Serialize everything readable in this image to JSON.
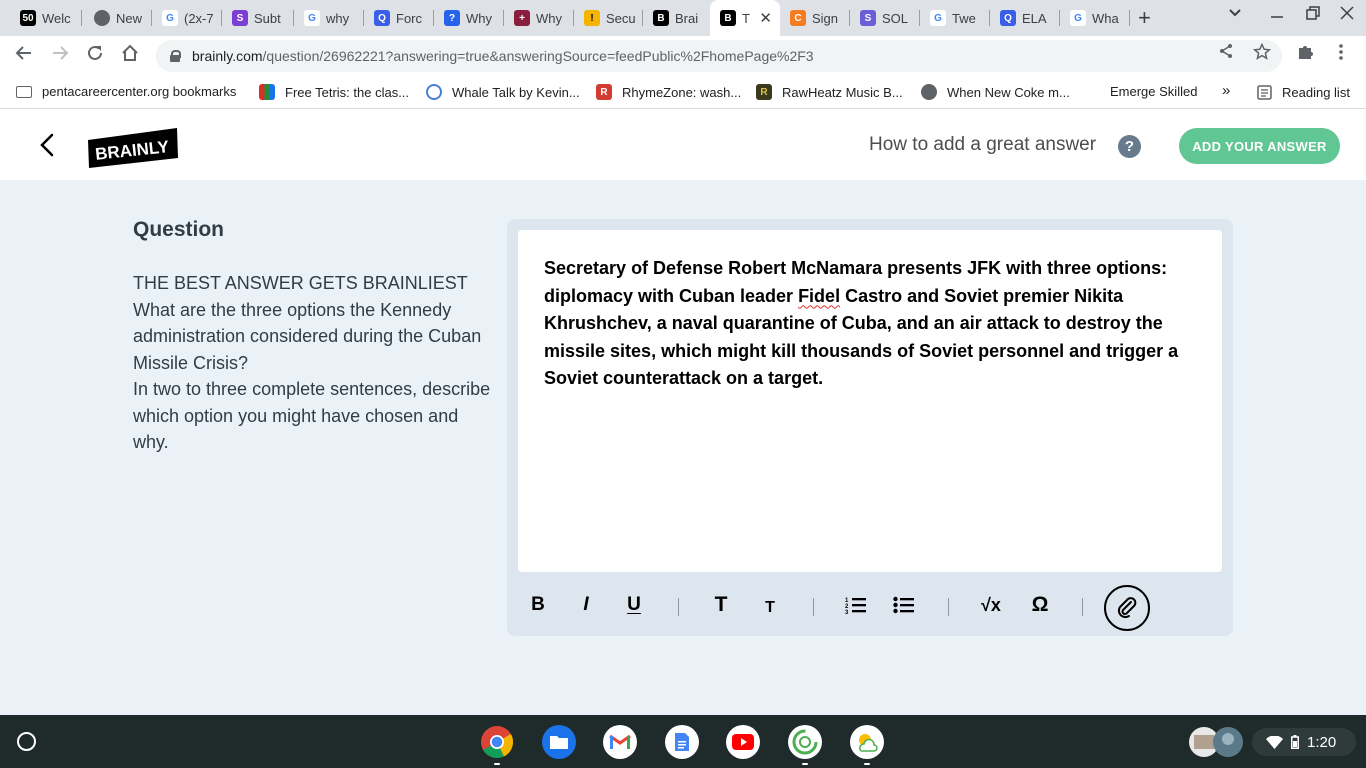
{
  "browser": {
    "tabs": [
      {
        "label": "Welc",
        "icon": "50"
      },
      {
        "label": "New",
        "icon": "chrome"
      },
      {
        "label": "(2x-7",
        "icon": "G"
      },
      {
        "label": "Subt",
        "icon": "S"
      },
      {
        "label": "why",
        "icon": "G"
      },
      {
        "label": "Forc",
        "icon": "Q"
      },
      {
        "label": "Why",
        "icon": "?"
      },
      {
        "label": "Why",
        "icon": "+"
      },
      {
        "label": "Secu",
        "icon": "!"
      },
      {
        "label": "Brai",
        "icon": "B"
      },
      {
        "label": "T",
        "icon": "B"
      },
      {
        "label": "Sign",
        "icon": "C"
      },
      {
        "label": "SOL",
        "icon": "S"
      },
      {
        "label": "Twe",
        "icon": "G"
      },
      {
        "label": "ELA",
        "icon": "Q"
      },
      {
        "label": "Wha",
        "icon": "G"
      }
    ],
    "url_domain": "brainly.com",
    "url_path": "/question/26962221?answering=true&answeringSource=feedPublic%2FhomePage%2F3",
    "bookmarks": [
      {
        "label": "pentacareercenter.org bookmarks"
      },
      {
        "label": "Free Tetris: the clas..."
      },
      {
        "label": "Whale Talk by Kevin..."
      },
      {
        "label": "RhymeZone: wash..."
      },
      {
        "label": "RawHeatz Music B..."
      },
      {
        "label": "When New Coke m..."
      },
      {
        "label": "Emerge Skilled"
      }
    ],
    "bookmarks_overflow": "»",
    "reading_list": "Reading list"
  },
  "header": {
    "logo_text": "BRAINLY",
    "how_to_label": "How to add a great answer",
    "help_symbol": "?",
    "add_answer_label": "ADD YOUR ANSWER"
  },
  "question": {
    "heading": "Question",
    "lines": [
      "THE BEST ANSWER GETS BRAINLIEST",
      "What are the three options the Kennedy administration considered during the Cuban Missile Crisis?",
      "In two to three complete sentences, describe which option you might have chosen and why."
    ]
  },
  "answer": {
    "before_misspelled": "Secretary of Defense Robert McNamara presents JFK with three options: diplomacy with Cuban leader ",
    "misspelled_word": "Fidel",
    "after_misspelled": " Castro and Soviet premier Nikita Khrushchev, a naval quarantine of Cuba, and an air attack to destroy the missile sites, which might kill thousands of Soviet personnel and trigger a Soviet counterattack on a target."
  },
  "toolbar": {
    "bold": "B",
    "italic": "I",
    "underline": "U",
    "heading_large": "T",
    "heading_small": "T",
    "math": "√x",
    "symbol": "Ω"
  },
  "system": {
    "time": "1:20"
  },
  "colors": {
    "brand_green": "#60c694",
    "page_background": "#ebf2f7",
    "taskbar": "#1f2a2a"
  }
}
